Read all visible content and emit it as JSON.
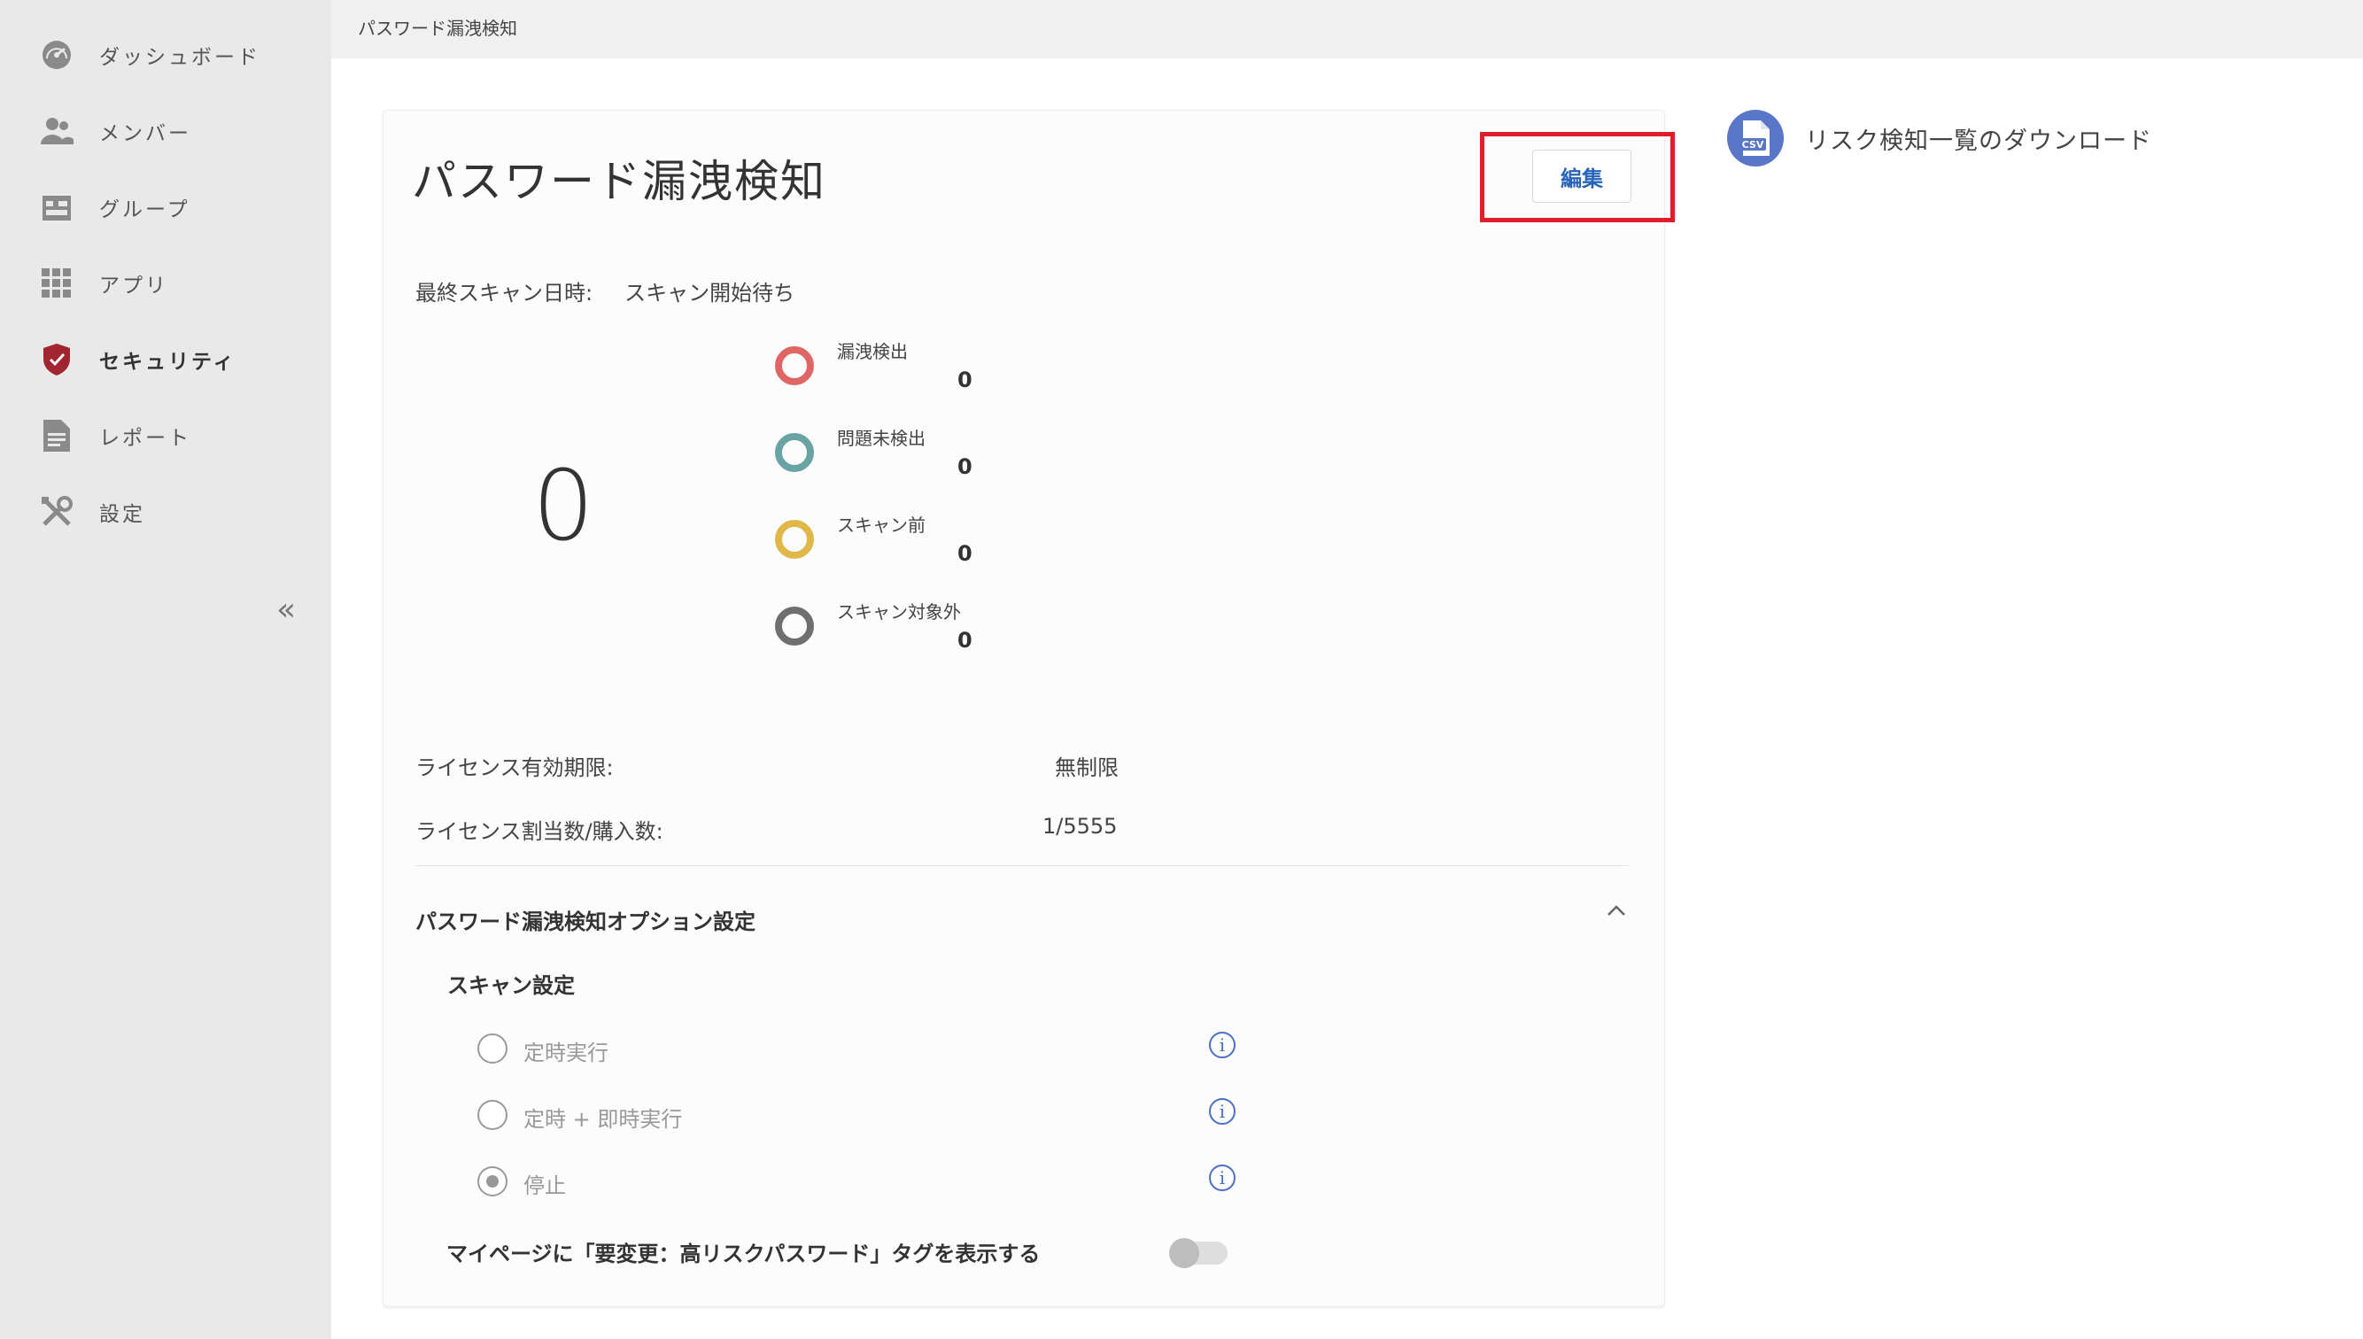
{
  "sidebar": {
    "items": [
      {
        "label": "ダッシュボード",
        "icon": "dashboard-icon"
      },
      {
        "label": "メンバー",
        "icon": "members-icon"
      },
      {
        "label": "グループ",
        "icon": "group-icon"
      },
      {
        "label": "アプリ",
        "icon": "apps-grid-icon"
      },
      {
        "label": "セキュリティ",
        "icon": "shield-icon"
      },
      {
        "label": "レポート",
        "icon": "report-icon"
      },
      {
        "label": "設定",
        "icon": "tools-icon"
      }
    ],
    "collapse_label": "«"
  },
  "breadcrumb": "パスワード漏洩検知",
  "card": {
    "title": "パスワード漏洩検知",
    "edit_label": "編集",
    "last_scan_label": "最終スキャン日時:",
    "last_scan_value": "スキャン開始待ち",
    "total": "0",
    "stats": [
      {
        "label": "漏洩検出",
        "value": "0",
        "color": "#e06666"
      },
      {
        "label": "問題未検出",
        "value": "0",
        "color": "#6aa3a3"
      },
      {
        "label": "スキャン前",
        "value": "0",
        "color": "#e0b84a"
      },
      {
        "label": "スキャン対象外",
        "value": "0",
        "color": "#6f6f6f"
      }
    ],
    "license_expiry_label": "ライセンス有効期限:",
    "license_expiry_value": "無制限",
    "license_alloc_label": "ライセンス割当数/購入数:",
    "license_alloc_value": "1/5555",
    "option_title": "パスワード漏洩検知オプション設定",
    "scan_setting_title": "スキャン設定",
    "scan_options": [
      {
        "label": "定時実行",
        "selected": false
      },
      {
        "label": "定時 + 即時実行",
        "selected": false
      },
      {
        "label": "停止",
        "selected": true
      }
    ],
    "toggle_label": "マイページに「要変更：高リスクパスワード」タグを表示する",
    "toggle_on": false
  },
  "download": {
    "label": "リスク検知一覧のダウンロード",
    "icon": "csv-file-icon",
    "icon_text": "CSV"
  },
  "colors": {
    "accent": "#2a64b8",
    "highlight": "#e01e2a",
    "security": "#a0252e"
  }
}
